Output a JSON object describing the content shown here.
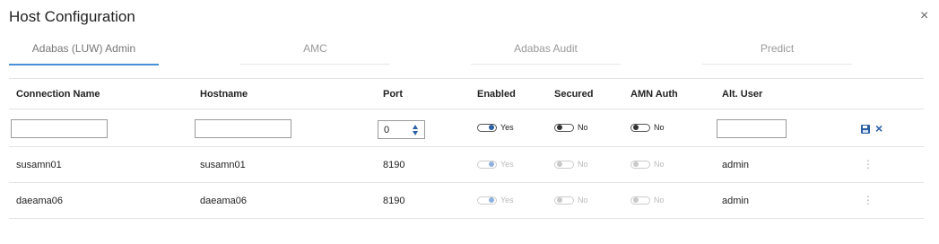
{
  "dialog": {
    "title": "Host Configuration",
    "close_glyph": "×"
  },
  "tabs": [
    {
      "label": "Adabas (LUW) Admin",
      "active": true
    },
    {
      "label": "AMC",
      "active": false
    },
    {
      "label": "Adabas Audit",
      "active": false
    },
    {
      "label": "Predict",
      "active": false
    }
  ],
  "table": {
    "headers": [
      "Connection Name",
      "Hostname",
      "Port",
      "Enabled",
      "Secured",
      "AMN Auth",
      "Alt. User"
    ],
    "new_row": {
      "connection_name": "",
      "hostname": "",
      "port": "0",
      "enabled": "Yes",
      "secured": "No",
      "amn_auth": "No",
      "alt_user": ""
    },
    "rows": [
      {
        "connection_name": "susamn01",
        "hostname": "susamn01",
        "port": "8190",
        "enabled": "Yes",
        "secured": "No",
        "amn_auth": "No",
        "alt_user": "admin",
        "menu": "⋮"
      },
      {
        "connection_name": "daeama06",
        "hostname": "daeama06",
        "port": "8190",
        "enabled": "Yes",
        "secured": "No",
        "amn_auth": "No",
        "alt_user": "admin",
        "menu": "⋮"
      }
    ]
  },
  "icons": {
    "save": "save-icon",
    "cancel": "close-icon",
    "row_menu": "more-vertical-icon"
  },
  "colors": {
    "accent": "#2b5fa6",
    "tab_underline": "#4a90d9"
  }
}
